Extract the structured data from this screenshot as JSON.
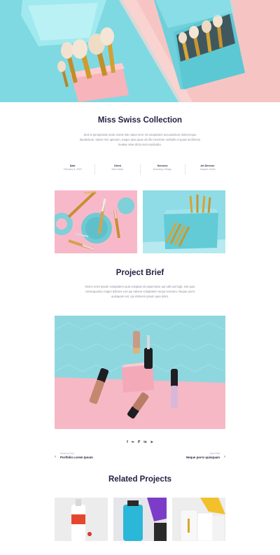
{
  "project": {
    "title": "Miss Swiss Collection",
    "intro": "Sed ut perspiciatis unde omnis iste natus error sit voluptatem accusantium doloremque laudantium, totam rem aperiam, eaque ipsa quae ab illo inventore veritatis et quasi architecto beatae vitae dicta sunt explicabo."
  },
  "meta": [
    {
      "label": "Date",
      "value": "February 5, 2020"
    },
    {
      "label": "Client",
      "value": "Miss Swiss"
    },
    {
      "label": "Services",
      "value": "Branding, Design"
    },
    {
      "label": "Art Director",
      "value": "Jacques Smith"
    }
  ],
  "brief": {
    "title": "Project Brief",
    "text": "Nemo enim ipsam voluptatem quia voluptas sit aspernatur aut odit aut fugit, sed quia consequuntur magni dolores eos qui ratione voluptatem sequi nesciunt. Neque porro quisquam est, qui dolorem ipsum quia dolor."
  },
  "post_nav": {
    "prev_small": "Previous Post",
    "prev_title": "Portfolio Lorem Ipsum",
    "next_small": "Next Post",
    "next_title": "Neque porro quisquam"
  },
  "social_icons": [
    "facebook-icon",
    "twitter-icon",
    "pinterest-icon",
    "linkedin-icon",
    "telegram-icon"
  ],
  "social_glyphs": [
    "f",
    "❧",
    "P",
    "in",
    "➤"
  ],
  "related": {
    "title": "Related Projects"
  },
  "colors": {
    "accent_dark": "#232144",
    "hero_cyan": "#7fd9e2",
    "hero_pink": "#f6c5c3",
    "pink_bg": "#f7b9c9",
    "blue_bg": "#8fdce6"
  }
}
